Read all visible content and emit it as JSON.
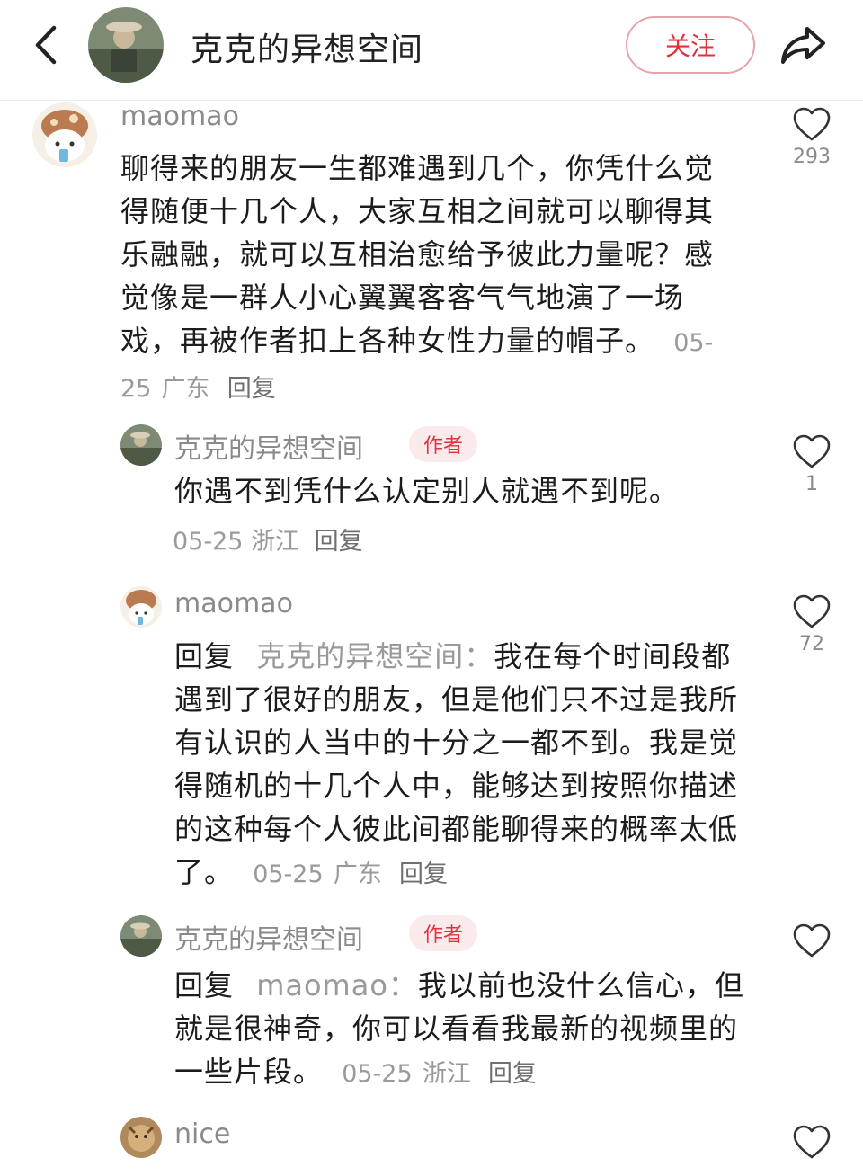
{
  "header": {
    "title": "克克的异想空间",
    "follow_label": "关注"
  },
  "comments": [
    {
      "username": "maomao",
      "text": "聊得来的朋友一生都难遇到几个，你凭什么觉得随便十几个人，大家互相之间就可以聊得其乐融融，就可以互相治愈给予彼此力量呢？感觉像是一群人小心翼翼客客气气地演了一场戏，再被作者扣上各种女性力量的帽子。",
      "date": "05-25",
      "location": "广东",
      "reply_label": "回复",
      "likes": "293"
    },
    {
      "username": "克克的异想空间",
      "badge": "作者",
      "text": "你遇不到凭什么认定别人就遇不到呢。",
      "date": "05-25",
      "location": "浙江",
      "reply_label": "回复",
      "likes": "1"
    },
    {
      "username": "maomao",
      "reply_prefix": "回复",
      "reply_to": "克克的异想空间",
      "text": "我在每个时间段都遇到了很好的朋友，但是他们只不过是我所有认识的人当中的十分之一都不到。我是觉得随机的十几个人中，能够达到按照你描述的这种每个人彼此间都能聊得来的概率太低了。",
      "date": "05-25",
      "location": "广东",
      "reply_label": "回复",
      "likes": "72"
    },
    {
      "username": "克克的异想空间",
      "badge": "作者",
      "reply_prefix": "回复",
      "reply_to": "maomao",
      "text": "我以前也没什么信心，但就是很神奇，你可以看看我最新的视频里的一些片段。",
      "date": "05-25",
      "location": "浙江",
      "reply_label": "回复",
      "likes": ""
    },
    {
      "username": "nice",
      "likes": ""
    }
  ],
  "icons": {
    "back": "chevron-left-icon",
    "share": "share-arrow-icon",
    "like": "heart-outline-icon"
  },
  "colors": {
    "accent": "#e0323d",
    "badge_bg": "#fbeaec",
    "muted": "#9a9a9a"
  }
}
